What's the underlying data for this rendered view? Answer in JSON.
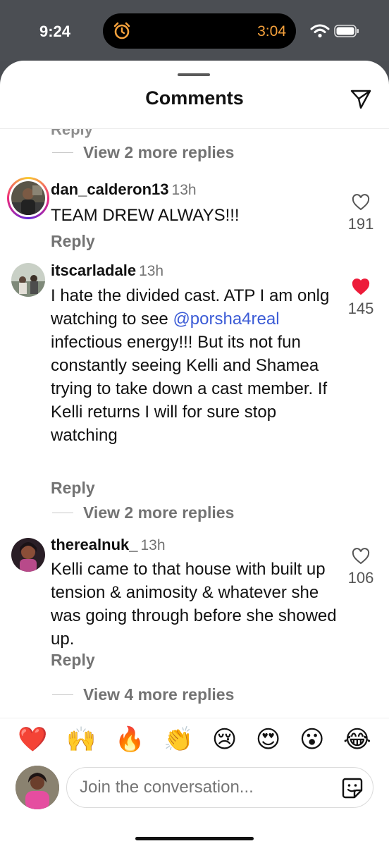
{
  "status_bar": {
    "time": "9:24",
    "island_time": "3:04",
    "island_icon": "alarm-clock-icon",
    "island_color": "#f5a13c"
  },
  "sheet": {
    "title": "Comments",
    "share_icon": "paper-plane-icon"
  },
  "thread": {
    "cutoff_reply_label": "Reply",
    "top_view_more": "View 2 more replies"
  },
  "comments": [
    {
      "username": "dan_calderon13",
      "time": "13h",
      "text": "TEAM DREW ALWAYS!!!",
      "reply_label": "Reply",
      "likes": "191",
      "liked": false,
      "has_story_ring": true
    },
    {
      "username": "itscarladale",
      "time": "13h",
      "text_before": "I hate the divided cast. ATP I am onlg watching to see ",
      "mention": "@porsha4real",
      "text_after": " infectious energy!!! But its not fun constantly seeing Kelli and Shamea trying to take down a cast member. If Kelli returns I will for sure stop watching",
      "reply_label": "Reply",
      "likes": "145",
      "liked": true,
      "view_more": "View 2 more replies"
    },
    {
      "username": "therealnuk_",
      "time": "13h",
      "text": "Kelli came to that house with built up tension & animosity & whatever she was going through before she showed up.",
      "reply_label": "Reply",
      "likes": "106",
      "liked": false,
      "view_more": "View 4 more replies"
    }
  ],
  "reactions": [
    "❤️",
    "🙌",
    "🔥",
    "👏",
    "😢",
    "😍",
    "😮",
    "😂"
  ],
  "composer": {
    "placeholder": "Join the conversation...",
    "sticker_icon": "sticker-icon"
  },
  "colors": {
    "like_red": "#ed1c3a",
    "mention_blue": "#3b5bd6",
    "muted_gray": "#737373"
  }
}
